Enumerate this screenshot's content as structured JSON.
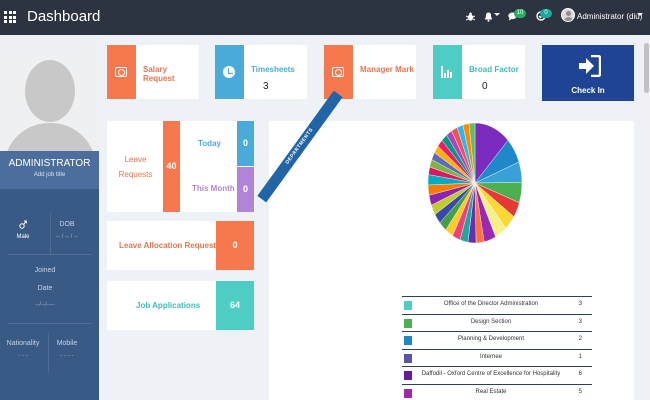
{
  "topbar": {
    "title": "Dashboard",
    "notifications_badge": "10",
    "updates_badge": "0",
    "user_name": "Administrator (diu)"
  },
  "sidebar": {
    "role": "ADMINISTRATOR",
    "job_title_placeholder": "Add job title",
    "gender_value": "Male",
    "dob_label": "DOB",
    "dob_value": "-- / -- / --",
    "joined_label": "Joined",
    "date_label": "Date",
    "date_value": "--/--/----",
    "nationality_label": "Nationality",
    "nationality_value": "- - -",
    "mobile_label": "Mobile",
    "mobile_value": "- - - -"
  },
  "cards": {
    "salary_request": {
      "label": "Salary Request",
      "color": "#f5784f"
    },
    "timesheets": {
      "label": "Timesheets",
      "count": "3",
      "color": "#4aabd8"
    },
    "manager_mark": {
      "label": "Manager Mark",
      "color": "#f5784f"
    },
    "broad_factor": {
      "label": "Broad Factor",
      "count": "0",
      "color": "#4ecdc4"
    },
    "checkin": {
      "label": "Check In",
      "color": "#1f4496"
    }
  },
  "leave": {
    "label_line1": "Leave",
    "label_line2": "Requests",
    "count": "40",
    "today_label": "Today",
    "today_value": "0",
    "month_label": "This Month",
    "month_value": "0"
  },
  "allocation": {
    "label": "Leave Allocation Requests",
    "count": "0"
  },
  "applications": {
    "label": "Job Applications",
    "count": "64"
  },
  "departments": {
    "ribbon": "DEPARTMENTS",
    "rows": [
      {
        "name": "Office of the Director Administration",
        "count": "3",
        "color": "#4ecdc4"
      },
      {
        "name": "Design Section",
        "count": "3",
        "color": "#4caf50"
      },
      {
        "name": "Planning & Development",
        "count": "2",
        "color": "#1e88c9"
      },
      {
        "name": "Internee",
        "count": "1",
        "color": "#5b55a6"
      },
      {
        "name": "Daffodil - Oxford Centre of Excellence for Hospitality",
        "count": "6",
        "color": "#6a1b9a"
      },
      {
        "name": "Real Estate",
        "count": "5",
        "color": "#9c27b0"
      }
    ]
  }
}
